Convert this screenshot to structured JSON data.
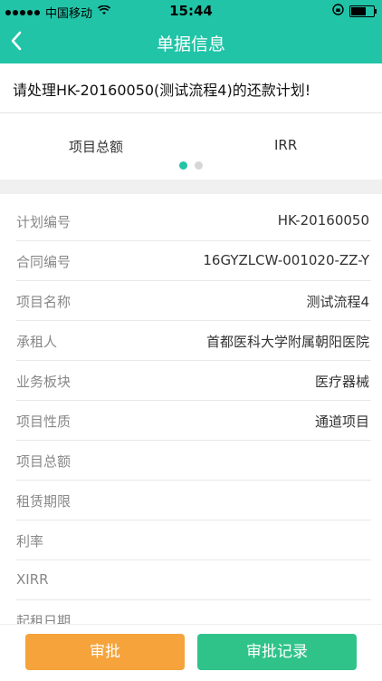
{
  "status_bar": {
    "carrier": "中国移动",
    "time": "15:44"
  },
  "nav": {
    "title": "单据信息"
  },
  "notice": {
    "text": "请处理HK-20160050(测试流程4)的还款计划!"
  },
  "tabs": {
    "items": [
      "项目总额",
      "IRR"
    ],
    "page_count": 2,
    "active_page": 1,
    "colors": {
      "active": "#21c4a7",
      "inactive": "#d6d6d6"
    }
  },
  "details": [
    {
      "label": "计划编号",
      "value": "HK-20160050"
    },
    {
      "label": "合同编号",
      "value": "16GYZLCW-001020-ZZ-Y"
    },
    {
      "label": "项目名称",
      "value": "测试流程4"
    },
    {
      "label": "承租人",
      "value": "首都医科大学附属朝阳医院"
    },
    {
      "label": "业务板块",
      "value": "医疗器械"
    },
    {
      "label": "项目性质",
      "value": "通道项目"
    },
    {
      "label": "项目总额",
      "value": ""
    },
    {
      "label": "租赁期限",
      "value": ""
    },
    {
      "label": "利率",
      "value": ""
    },
    {
      "label": "XIRR",
      "value": ""
    },
    {
      "label": "起租日期",
      "value": ""
    }
  ],
  "actions": {
    "approve": "审批",
    "record": "审批记录"
  },
  "colors": {
    "primary": "#21c4a7",
    "approve": "#f5a33a",
    "record": "#2fc38a"
  },
  "icons": {
    "back": "chevron-left-icon",
    "wifi": "wifi-icon",
    "lock": "rotation-lock-icon",
    "battery": "battery-icon"
  }
}
